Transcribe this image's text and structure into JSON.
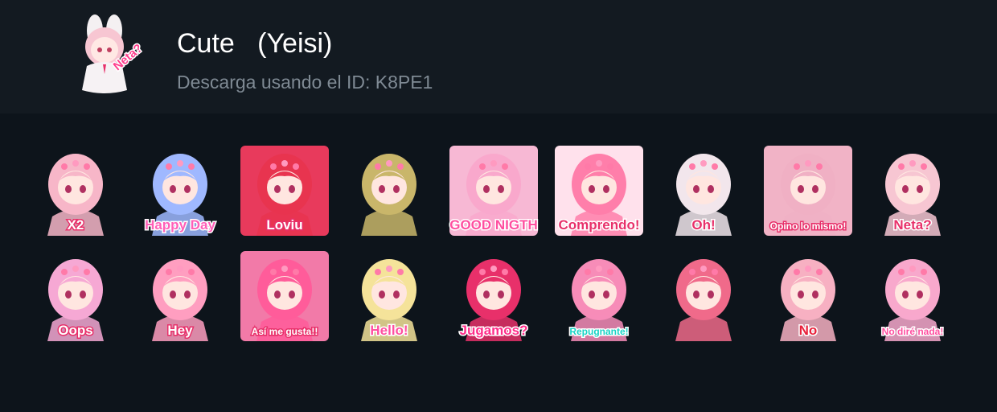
{
  "pack": {
    "title": "Cute   (Yeisi)",
    "subtitle": "Descarga usando el ID: K8PE1",
    "thumbnail_caption": "Neta?"
  },
  "stickers": [
    {
      "caption": "X2",
      "hair": "#f7b6c8",
      "accent": "#ffffff",
      "bg": ""
    },
    {
      "caption": "Happy Day",
      "hair": "#9fb8ff",
      "accent": "#ff5fb8",
      "bg": ""
    },
    {
      "caption": "Loviu",
      "hair": "#e8344f",
      "accent": "#ffffff",
      "bg": "#e83a5c"
    },
    {
      "caption": "",
      "hair": "#c9b66a",
      "accent": "#f0c020",
      "bg": ""
    },
    {
      "caption": "GOOD NIGTH",
      "hair": "#f9a8cc",
      "accent": "#ff4fa0",
      "bg": "#f7b8d4"
    },
    {
      "caption": "Comprendo!",
      "hair": "#ff7eaa",
      "accent": "#e8306a",
      "bg": "#ffe1ec"
    },
    {
      "caption": "Oh!",
      "hair": "#f2e6ec",
      "accent": "#e8306a",
      "bg": ""
    },
    {
      "caption": "Opino lo mismo!",
      "hair": "#f0b0c4",
      "accent": "#ffffff",
      "bg": "#f1b3c6"
    },
    {
      "caption": "Neta?",
      "hair": "#f7c6d2",
      "accent": "#e8306a",
      "bg": ""
    },
    {
      "caption": "Oops",
      "hair": "#f6a8d4",
      "accent": "#ffffff",
      "bg": ""
    },
    {
      "caption": "Hey",
      "hair": "#ff9ec0",
      "accent": "#ffffff",
      "bg": ""
    },
    {
      "caption": "Así me gusta!!",
      "hair": "#ff5c9a",
      "accent": "#ffffff",
      "bg": "#f27aa8"
    },
    {
      "caption": "Hello!",
      "hair": "#f5e39a",
      "accent": "#ff4fa0",
      "bg": ""
    },
    {
      "caption": "Jugamos?",
      "hair": "#e8306a",
      "accent": "#ff2d8a",
      "bg": ""
    },
    {
      "caption": "Repugnante!",
      "hair": "#f78cb8",
      "accent": "#19d3c5",
      "bg": ""
    },
    {
      "caption": "",
      "hair": "#f06a8a",
      "accent": "#ffffff",
      "bg": ""
    },
    {
      "caption": "No",
      "hair": "#f7b0c2",
      "accent": "#e8203a",
      "bg": ""
    },
    {
      "caption": "No diré nada!",
      "hair": "#f8a8cc",
      "accent": "#ff4fa0",
      "bg": ""
    }
  ]
}
